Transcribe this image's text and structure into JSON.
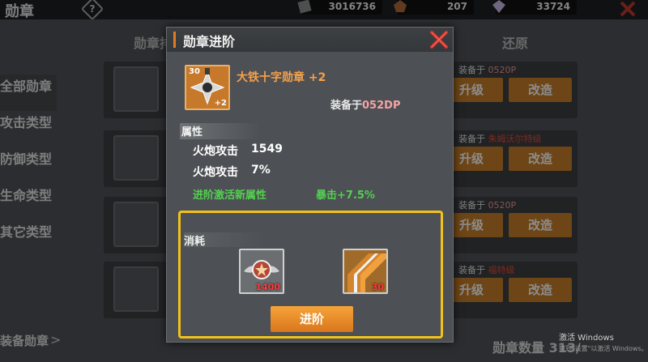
{
  "screen_title": "勋章",
  "help_icon_glyph": "?",
  "resources": [
    {
      "icon": "steel-plate-icon",
      "value": "3016736"
    },
    {
      "icon": "medal-badge-icon",
      "value": "207"
    },
    {
      "icon": "diamond-icon",
      "value": "33724"
    }
  ],
  "columns": {
    "list": "勋章排",
    "filter": "升级",
    "restore": "还原"
  },
  "sidebar": {
    "items": [
      "全部勋章",
      "攻击类型",
      "防御类型",
      "生命类型",
      "其它类型"
    ],
    "active_index": 0,
    "equip_label": "装备勋章",
    "arrow": ">"
  },
  "rows": [
    {
      "equip_label": "装备于",
      "equip_who": "0520P",
      "who_red": false,
      "upgrade": "升级",
      "modify": "改造"
    },
    {
      "equip_label": "装备于",
      "equip_who": "朱姆沃尔特级",
      "who_red": true,
      "upgrade": "升级",
      "modify": "改造"
    },
    {
      "equip_label": "装备于",
      "equip_who": "0520P",
      "who_red": false,
      "upgrade": "升级",
      "modify": "改造"
    },
    {
      "equip_label": "装备于",
      "equip_who": "福特级",
      "who_red": true,
      "upgrade": "升级",
      "modify": "改造"
    }
  ],
  "bottom_count": "勋章数量 313/",
  "watermark": {
    "line1": "激活 Windows",
    "line2": "转到\"设置\"以激活 Windows。"
  },
  "modal": {
    "title": "勋章进阶",
    "medal": {
      "level": "30",
      "plus": "+2",
      "name": "大铁十字勋章 +2"
    },
    "equipped_label": "装备于",
    "equipped_who": "052DP",
    "attributes_title": "属性",
    "attributes": [
      {
        "name": "火炮攻击",
        "value": "1549"
      },
      {
        "name": "火炮攻击",
        "value": "7%"
      }
    ],
    "unlock_label": "进阶激活新属性",
    "unlock_value": "暴击+7.5%",
    "cost_title": "消耗",
    "costs": [
      {
        "icon": "winged-medal-icon",
        "count": "1400"
      },
      {
        "icon": "ribbon-icon",
        "count": "30"
      }
    ],
    "advance_button": "进阶"
  }
}
